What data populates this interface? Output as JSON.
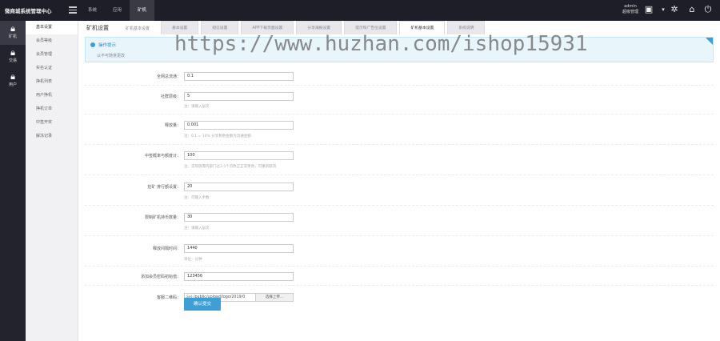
{
  "header": {
    "brand": "微商城系统管理中心",
    "nav": [
      "系统",
      "应用",
      "矿机"
    ],
    "user_name": "admin",
    "user_role": "超级管理",
    "icons": [
      "menu-icon",
      "qr-icon",
      "settings-icon",
      "home-icon",
      "power-icon"
    ]
  },
  "rail": [
    {
      "label": "矿机",
      "icon": "lock-icon"
    },
    {
      "label": "交易",
      "icon": "lock-icon"
    },
    {
      "label": "用户",
      "icon": "lock-icon"
    }
  ],
  "sidebar": {
    "items": [
      "基本设置",
      "会员等级",
      "会员管理",
      "实名认证",
      "挣机列表",
      "用户挣机",
      "挣机订单",
      "中签开奖",
      "解冻记录"
    ]
  },
  "page": {
    "title": "矿机设置",
    "subtitle": "矿机基本设置"
  },
  "tabs": [
    "基本设置",
    "短信设置",
    "APP下载页面设置",
    "分享海报设置",
    "提示和广告位设置",
    "矿机基本设置",
    "系统说明"
  ],
  "tips": {
    "title": "操作提示",
    "line": "以不可随意更改"
  },
  "form": {
    "fields": [
      {
        "label": "全网总流通：",
        "value": "0.1",
        "hint": ""
      },
      {
        "label": "社群层级：",
        "value": "5",
        "hint": "注：请输入层次"
      },
      {
        "label": "释放量：",
        "value": "0.001",
        "hint": "注：0.1 = 10% 分享剩余金额为流通金额"
      },
      {
        "label": "中签概率与额度计：",
        "value": "100",
        "hint": "注：实际值需内部门过3.5个可改正正常更改，可重新取消"
      },
      {
        "label": "挖矿 排行额设置：",
        "value": "20",
        "hint": "注：可输入手数"
      },
      {
        "label": "限制矿机持币数量：",
        "value": "30",
        "hint": "注：请输入层次"
      },
      {
        "label": "释放间隔时间：",
        "value": "1440",
        "hint": "单位：分钟"
      },
      {
        "label": "添加会员密码初始值：",
        "value": "123456",
        "hint": ""
      }
    ],
    "qr": {
      "label": "客服二维码：",
      "file_icon": "Sel",
      "path": "/public/upload/logo/2019/0",
      "button": "选择上传..."
    },
    "submit": "确认提交"
  },
  "watermark": "https://www.huzhan.com/ishop15931"
}
